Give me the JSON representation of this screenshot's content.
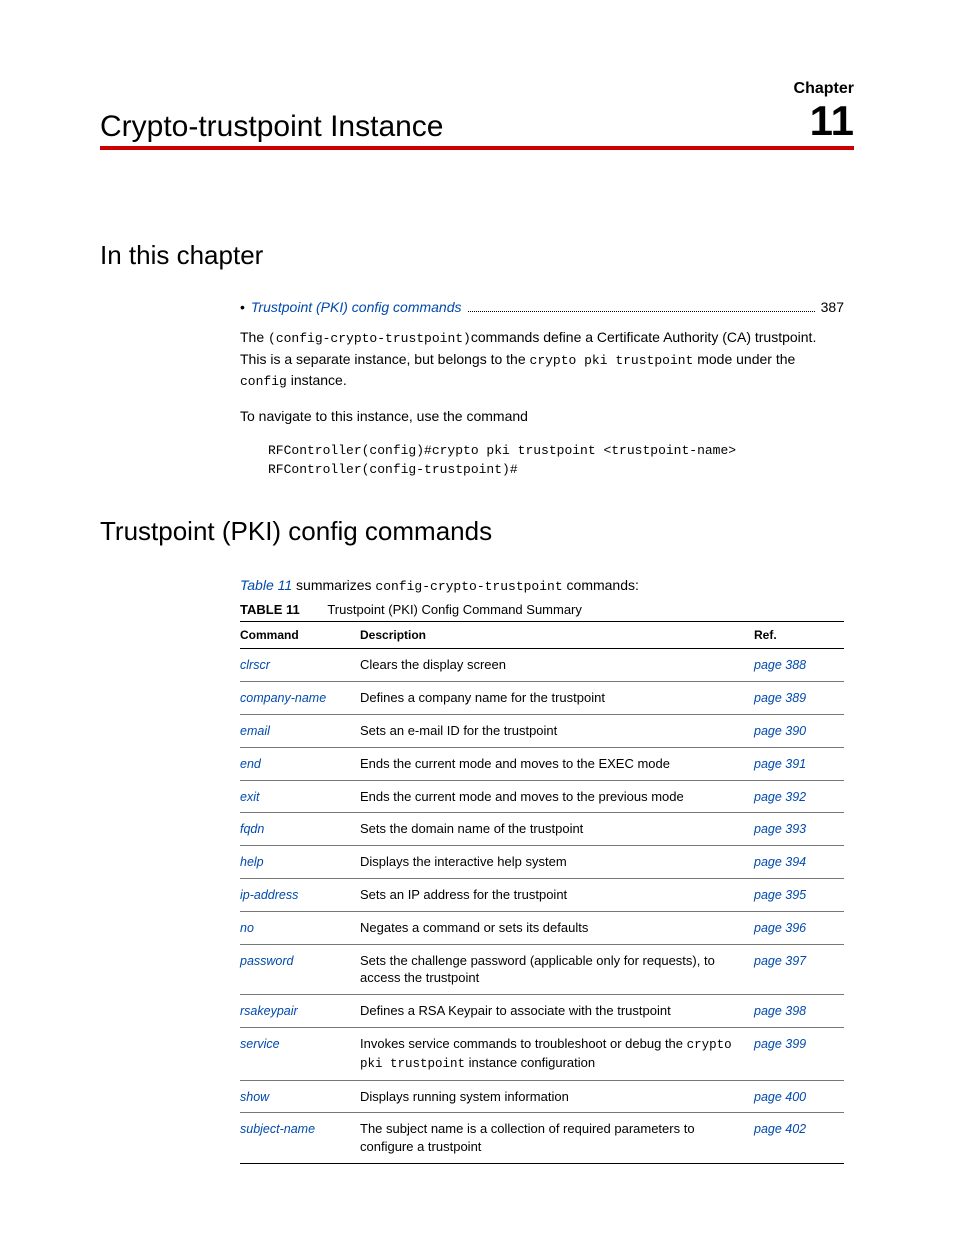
{
  "chapter": {
    "label": "Chapter",
    "number": "11",
    "title": "Crypto-trustpoint Instance"
  },
  "section1": {
    "heading": "In this chapter",
    "toc": {
      "item": "Trustpoint (PKI) config commands",
      "page": "387"
    },
    "para1_prefix": "The ",
    "para1_code1": "(config-crypto-trustpoint)",
    "para1_mid1": "commands define a Certificate Authority (CA) trustpoint. This is a separate instance, but belongs to the ",
    "para1_code2": "crypto pki trustpoint",
    "para1_mid2": " mode under the ",
    "para1_code3": "config",
    "para1_suffix": " instance.",
    "para2": "To navigate to this instance, use the command",
    "code_line1": "RFController(config)#crypto pki trustpoint <trustpoint-name>",
    "code_line2": "RFController(config-trustpoint)#"
  },
  "section2": {
    "heading": "Trustpoint (PKI) config commands",
    "intro_link": "Table 11",
    "intro_mid": " summarizes ",
    "intro_code": "config-crypto-trustpoint",
    "intro_suffix": " commands:",
    "table_caption_label": "TABLE 11",
    "table_caption_title": "Trustpoint (PKI) Config Command Summary",
    "headers": {
      "c1": "Command",
      "c2": "Description",
      "c3": "Ref."
    },
    "rows": [
      {
        "cmd": "clrscr",
        "desc": "Clears the display screen",
        "desc_mono": "",
        "ref": "page 388"
      },
      {
        "cmd": "company-name",
        "desc": "Defines a company name for the trustpoint",
        "desc_mono": "",
        "ref": "page 389"
      },
      {
        "cmd": "email",
        "desc": "Sets an e-mail ID for the trustpoint",
        "desc_mono": "",
        "ref": "page 390"
      },
      {
        "cmd": "end",
        "desc": "Ends the current mode and moves to the EXEC mode",
        "desc_mono": "",
        "ref": "page 391"
      },
      {
        "cmd": "exit",
        "desc": "Ends the current mode and moves to the previous mode",
        "desc_mono": "",
        "ref": "page 392"
      },
      {
        "cmd": "fqdn",
        "desc": "Sets the domain name of the trustpoint",
        "desc_mono": "",
        "ref": "page 393"
      },
      {
        "cmd": "help",
        "desc": "Displays the interactive help system",
        "desc_mono": "",
        "ref": "page 394"
      },
      {
        "cmd": "ip-address",
        "desc": "Sets an IP address for the trustpoint",
        "desc_mono": "",
        "ref": "page 395"
      },
      {
        "cmd": "no",
        "desc": "Negates a command or sets its defaults",
        "desc_mono": "",
        "ref": "page 396"
      },
      {
        "cmd": "password",
        "desc": "Sets the challenge password (applicable only for requests), to access the trustpoint",
        "desc_mono": "",
        "ref": "page 397"
      },
      {
        "cmd": "rsakeypair",
        "desc": "Defines a RSA Keypair to associate with the trustpoint",
        "desc_mono": "",
        "ref": "page 398"
      },
      {
        "cmd": "service",
        "desc": "Invokes service commands to troubleshoot or debug the ",
        "desc_mono": "crypto pki trustpoint",
        "desc_suffix": " instance configuration",
        "ref": "page 399"
      },
      {
        "cmd": "show",
        "desc": "Displays running system information",
        "desc_mono": "",
        "ref": "page 400"
      },
      {
        "cmd": "subject-name",
        "desc": "The subject name is a collection of required parameters to configure a trustpoint",
        "desc_mono": "",
        "ref": "page 402"
      }
    ]
  }
}
